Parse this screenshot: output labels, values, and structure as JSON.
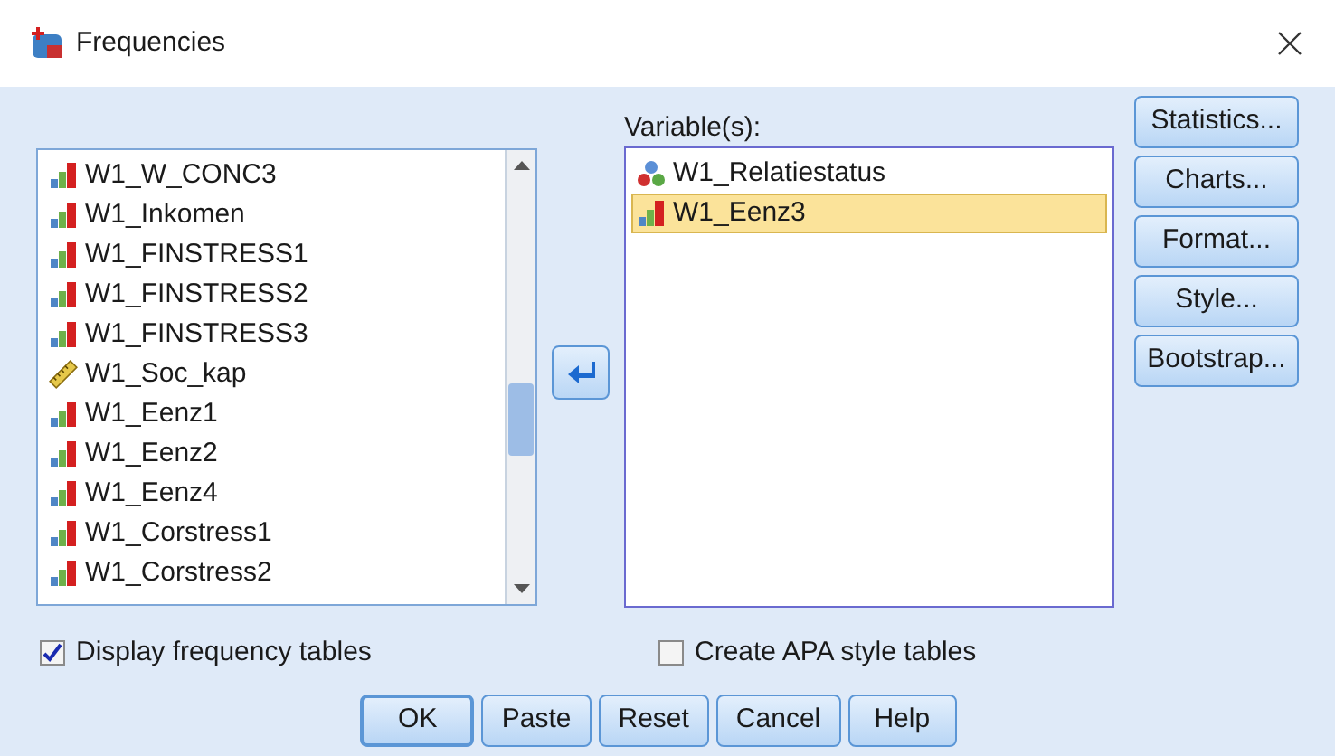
{
  "window": {
    "title": "Frequencies"
  },
  "source_list": {
    "items": [
      {
        "label": "W1_W_CONC3",
        "kind": "ordinal",
        "selected": false
      },
      {
        "label": "W1_Inkomen",
        "kind": "ordinal",
        "selected": false
      },
      {
        "label": "W1_FINSTRESS1",
        "kind": "ordinal",
        "selected": false
      },
      {
        "label": "W1_FINSTRESS2",
        "kind": "ordinal",
        "selected": false
      },
      {
        "label": "W1_FINSTRESS3",
        "kind": "ordinal",
        "selected": false
      },
      {
        "label": "W1_Soc_kap",
        "kind": "scale",
        "selected": false
      },
      {
        "label": "W1_Eenz1",
        "kind": "ordinal",
        "selected": false
      },
      {
        "label": "W1_Eenz2",
        "kind": "ordinal",
        "selected": false
      },
      {
        "label": "W1_Eenz4",
        "kind": "ordinal",
        "selected": false
      },
      {
        "label": "W1_Corstress1",
        "kind": "ordinal",
        "selected": false
      },
      {
        "label": "W1_Corstress2",
        "kind": "ordinal",
        "selected": false
      }
    ]
  },
  "variables": {
    "label": "Variable(s):",
    "items": [
      {
        "label": "W1_Relatiestatus",
        "kind": "nominal",
        "selected": false
      },
      {
        "label": "W1_Eenz3",
        "kind": "ordinal",
        "selected": true
      }
    ]
  },
  "side_buttons": [
    "Statistics...",
    "Charts...",
    "Format...",
    "Style...",
    "Bootstrap..."
  ],
  "display_frequency_tables": {
    "label": "Display frequency tables",
    "checked": true
  },
  "create_apa_tables": {
    "label": "Create APA style tables",
    "checked": false
  },
  "buttons": [
    "OK",
    "Paste",
    "Reset",
    "Cancel",
    "Help"
  ]
}
